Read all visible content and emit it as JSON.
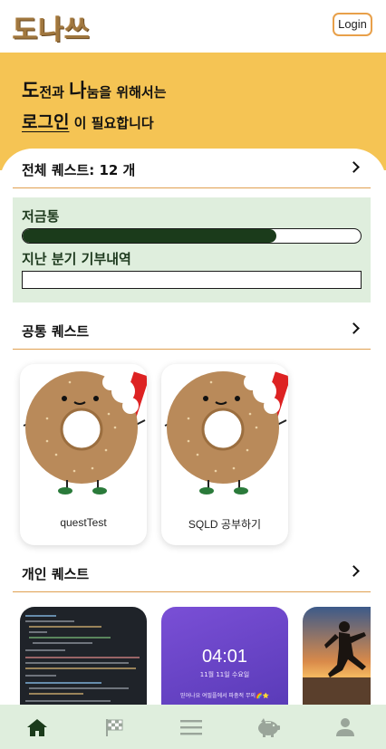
{
  "header": {
    "logo": "도나쓰",
    "login_label": "Login"
  },
  "banner": {
    "line1_big1": "도",
    "line1_text1": "전과 ",
    "line1_big2": "나",
    "line1_text2": "눔을 위해서는",
    "line2_big": "로그인",
    "line2_text": " 이 필요합니다"
  },
  "total_quests": {
    "label": "전체 퀘스트:  12 개"
  },
  "savings": {
    "piggy_label": "저금통",
    "piggy_progress": 0.75,
    "last_quarter_label": "지난 분기 기부내역",
    "last_quarter_progress": 0
  },
  "common_quests": {
    "title": "공통 퀘스트",
    "items": [
      {
        "name": "questTest",
        "image": "donut-mascot"
      },
      {
        "name": "SQLD 공부하기",
        "image": "donut-mascot"
      }
    ]
  },
  "personal_quests": {
    "title": "개인 퀘스트",
    "items": [
      {
        "image": "code-editor-screenshot"
      },
      {
        "image": "phone-lockscreen",
        "time": "04:01",
        "date": "11월 11일 수요일",
        "caption": "믿어나요 여필플에서 파충적 무의🌈⭐"
      },
      {
        "image": "runner-sunset-photo"
      }
    ]
  },
  "nav": {
    "items": [
      {
        "icon": "home-icon",
        "active": true
      },
      {
        "icon": "checkered-flag-icon",
        "active": false
      },
      {
        "icon": "menu-icon",
        "active": false
      },
      {
        "icon": "piggy-bank-icon",
        "active": false
      },
      {
        "icon": "user-icon",
        "active": false
      }
    ],
    "active_color": "#1b3b1b",
    "inactive_color": "#9aa59a"
  },
  "colors": {
    "accent": "#f5c454",
    "panel_green": "#dfeedd",
    "progress_fill": "#1b3b1b",
    "divider": "#e0a050"
  }
}
